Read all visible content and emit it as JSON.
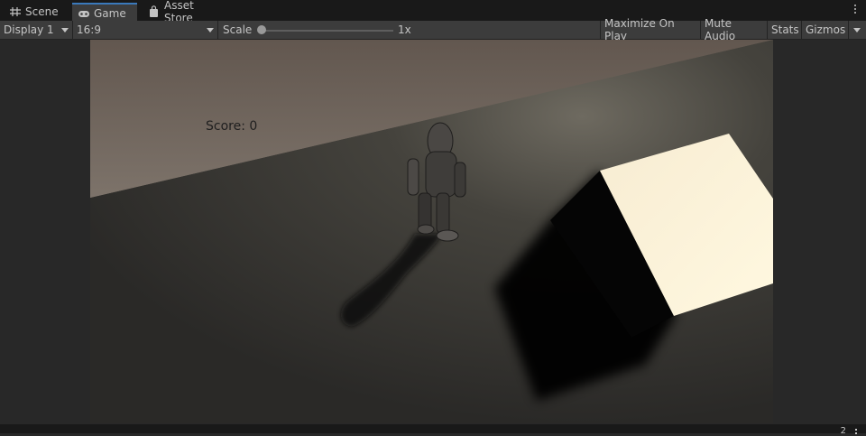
{
  "tabs": [
    {
      "label": "Scene",
      "icon": "scene-grid-icon"
    },
    {
      "label": "Game",
      "icon": "gamepad-icon",
      "active": true
    },
    {
      "label": "Asset Store",
      "icon": "shopping-bag-icon"
    }
  ],
  "toolbar": {
    "display": "Display 1",
    "aspect": "16:9",
    "scale_label": "Scale",
    "scale_value": "1x",
    "scale_level": 0,
    "maximize_on_play": "Maximize On Play",
    "mute_audio": "Mute Audio",
    "stats": "Stats",
    "gizmos": "Gizmos"
  },
  "game": {
    "score_text": "Score: 0"
  },
  "status": {
    "count": "2"
  },
  "colors": {
    "background": "#282828",
    "tabbar": "#191919",
    "toolbar": "#3c3c3c",
    "active_tab_accent": "#3a79bb",
    "text": "#c4c4c4"
  }
}
